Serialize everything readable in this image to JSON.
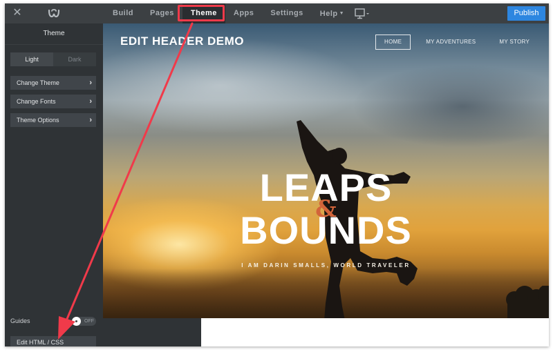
{
  "app": {
    "close_icon": "close-icon",
    "logo_icon": "weebly-logo-icon"
  },
  "topbar": {
    "nav": [
      {
        "label": "Build",
        "active": false
      },
      {
        "label": "Pages",
        "active": false
      },
      {
        "label": "Theme",
        "active": true
      },
      {
        "label": "Apps",
        "active": false
      },
      {
        "label": "Settings",
        "active": false
      },
      {
        "label": "Help",
        "active": false,
        "has_dropdown": true
      }
    ],
    "device_icon": "desktop-monitor-icon",
    "publish_label": "Publish",
    "publish_color": "#2d86e0"
  },
  "sidebar": {
    "title": "Theme",
    "style_toggle": {
      "options": [
        "Light",
        "Dark"
      ],
      "selected": "Light"
    },
    "items": [
      {
        "label": "Change Theme"
      },
      {
        "label": "Change Fonts"
      },
      {
        "label": "Theme Options"
      }
    ],
    "guides_label": "Guides",
    "guides_state": "OFF",
    "edit_html_label": "Edit HTML / CSS"
  },
  "site": {
    "title": "EDIT HEADER DEMO",
    "nav": [
      {
        "label": "HOME",
        "active": true
      },
      {
        "label": "MY ADVENTURES",
        "active": false
      },
      {
        "label": "MY STORY",
        "active": false
      }
    ],
    "hero_line1": "LEAPS",
    "hero_amp": "&",
    "hero_line2": "BOUNDS",
    "tagline": "I AM DARIN SMALLS, WORLD TRAVELER",
    "amp_color": "#d2643a"
  },
  "annotations": {
    "highlight_color": "#f03a4a",
    "highlight_target": "Theme",
    "arrow_target": "Edit HTML / CSS"
  }
}
